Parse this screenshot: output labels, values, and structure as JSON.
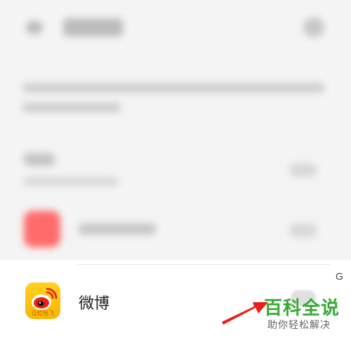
{
  "app_item": {
    "name": "微博",
    "icon": "weibo-app-icon",
    "icon_caption": "让红包飞"
  },
  "watermark": {
    "title": "百科全说",
    "subtitle": "助你轻松解决"
  },
  "edge_letter": "G",
  "colors": {
    "brand_yellow": "#f7b500",
    "watermark_green": "#39a836",
    "pointer_red": "#e8201a"
  }
}
